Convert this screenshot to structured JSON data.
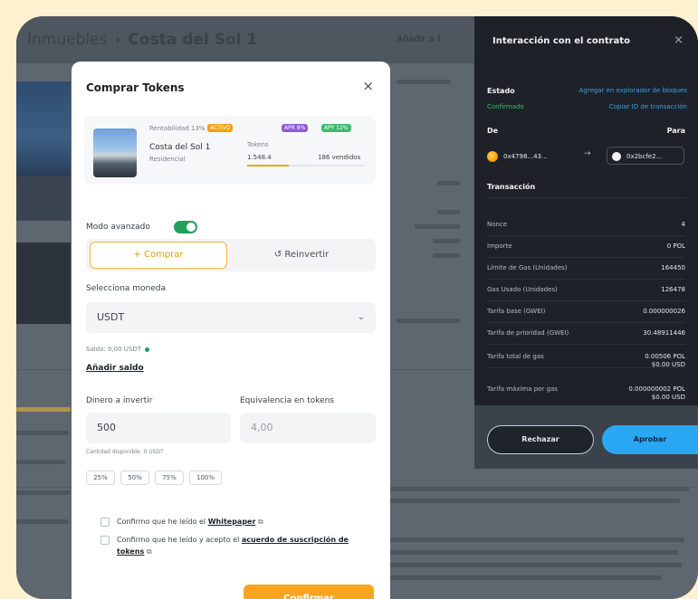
{
  "background": {
    "breadcrumb_prev": "Inmuebles",
    "breadcrumb_sep": "›",
    "breadcrumb_current": "Costa del Sol 1",
    "header_link": "Añadir a f"
  },
  "buy_modal": {
    "title": "Comprar Tokens",
    "close_icon": "×",
    "property": {
      "chip_left": "Rentabilidad 13%",
      "chip_left_badge": "ACTIVO",
      "chip_right_1": "APR 8%",
      "chip_right_2": "APY 12%",
      "name": "Costa del Sol 1",
      "type": "Residencial",
      "tokens_label": "Tokens",
      "tokens_value": "1.548.4",
      "tokens_sold": "186 vendidos"
    },
    "mode_label": "Modo avanzado",
    "mode_on": true,
    "tabs": [
      "+ Comprar",
      "↺ Reinvertir"
    ],
    "currency_label": "Selecciona moneda",
    "currency_value": "USDT",
    "balance_text": "Saldo: 0,00 USDT",
    "add_balance": "Añadir saldo",
    "amount_label": "Dinero a invertir",
    "amount_value": "500",
    "equivalence_label": "Equivalencia en tokens",
    "equivalence_value": "4,00",
    "min_note": "Cantidad disponible: 0 USDT",
    "percents": [
      "25%",
      "50%",
      "75%",
      "100%"
    ],
    "check1_text": "Confirmo que he leído el ",
    "check1_link": "Whitepaper",
    "check2_text": "Confirmo que he leído y acepto el ",
    "check2_link": "acuerdo de suscripción de tokens",
    "confirm_label": "Confirmar"
  },
  "contract_panel": {
    "title": "Interacción con el contrato",
    "close_icon": "×",
    "status_label": "Estado",
    "status_link": "Agregar en explorador de bloques",
    "status_value": "Confirmado",
    "status_link2": "Copiar ID de transacción",
    "from_label": "De",
    "to_label": "Para",
    "from_addr": "0x4798...43...",
    "to_addr": "0x2bcfe2...",
    "arrow": "→",
    "tx_title": "Transacción",
    "rows": [
      {
        "label": "Nonce",
        "value": "4"
      },
      {
        "label": "Importe",
        "value": "0 POL"
      },
      {
        "label": "Límite de Gas (Unidades)",
        "value": "164450"
      },
      {
        "label": "Gas Usado (Unidades)",
        "value": "126478"
      },
      {
        "label": "Tarifa base (GWEI)",
        "value": "0.000000026"
      },
      {
        "label": "Tarifa de prioridad (GWEI)",
        "value": "30.48911446"
      },
      {
        "label": "Tarifa total de gas",
        "value": "0.00506 POL\n$0.00 USD"
      },
      {
        "label": "Tarifa máxima por gas",
        "value": "0.000000002 POL\n$0.00 USD"
      }
    ],
    "reject_label": "Rechazar",
    "approve_label": "Aprobar"
  }
}
